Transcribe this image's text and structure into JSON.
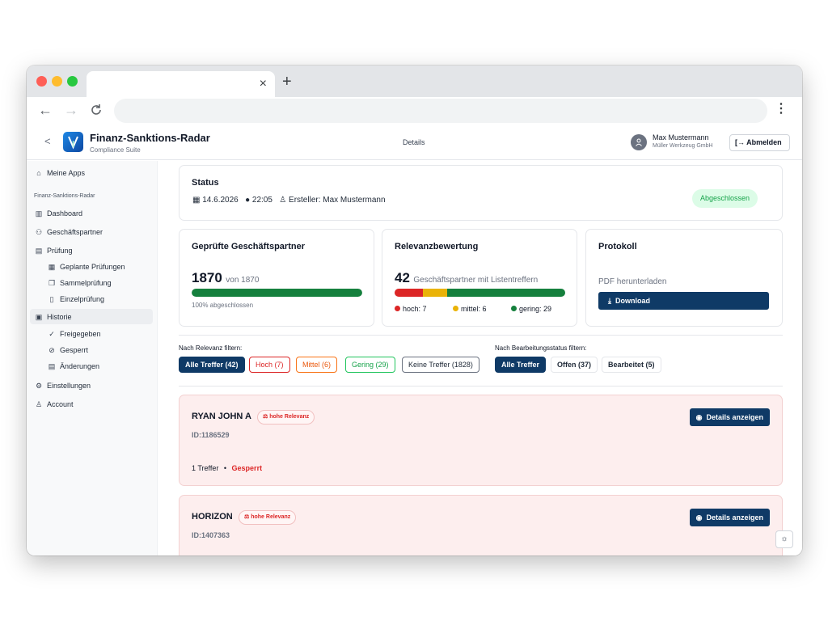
{
  "browser": {
    "tab_close": "×",
    "new_tab": "+",
    "back": "←",
    "forward": "→",
    "reload": "C",
    "menu": "⋮"
  },
  "header": {
    "back": "<",
    "app_title": "Finanz-Sanktions-Radar",
    "app_subtitle": "Compliance Suite",
    "center": "Details",
    "user_name": "Max Mustermann",
    "user_company": "Müller Werkzeug GmbH",
    "logout": "Abmelden"
  },
  "sidebar": {
    "my_apps": "Meine Apps",
    "section": "Finanz-Sanktions-Radar",
    "dashboard": "Dashboard",
    "partners": "Geschäftspartner",
    "pruefung": "Prüfung",
    "geplant": "Geplante Prüfungen",
    "sammel": "Sammelprüfung",
    "einzel": "Einzelprüfung",
    "historie": "Historie",
    "freigegeben": "Freigegeben",
    "gesperrt": "Gesperrt",
    "aenderungen": "Änderungen",
    "einstellungen": "Einstellungen",
    "account": "Account"
  },
  "status": {
    "title": "Status",
    "date": "14.6.2026",
    "time": "22:05",
    "creator": "Ersteller: Max Mustermann",
    "badge": "Abgeschlossen"
  },
  "checked": {
    "title": "Geprüfte Geschäftspartner",
    "count": "1870",
    "of": "von 1870",
    "progress": 1.0,
    "progress_text": "100% abgeschlossen"
  },
  "relevance": {
    "title": "Relevanzbewertung",
    "count": "42",
    "text": "Geschäftspartner mit Listentreffern",
    "high": "hoch: 7",
    "medium": "mittel: 6",
    "low": "gering: 29",
    "segments": [
      7,
      6,
      29
    ],
    "colors": {
      "high": "#dc2626",
      "medium": "#eab308",
      "low": "#15803d"
    }
  },
  "protocol": {
    "title": "Protokoll",
    "text": "PDF herunterladen",
    "button": "Download"
  },
  "filters": {
    "relevance_label": "Nach Relevanz filtern:",
    "status_label": "Nach Bearbeitungsstatus filtern:",
    "all": "Alle Treffer (42)",
    "high": "Hoch (7)",
    "medium": "Mittel (6)",
    "low": "Gering (29)",
    "none": "Keine Treffer (1828)",
    "status_all": "Alle Treffer",
    "open": "Offen (37)",
    "done": "Bearbeitet (5)"
  },
  "results": [
    {
      "name": "RYAN JOHN A",
      "badge": "hohe Relevanz",
      "id": "ID:1186529",
      "hits": "1 Treffer",
      "sep": "•",
      "state": "Gesperrt",
      "button": "Details anzeigen"
    },
    {
      "name": "HORIZON",
      "badge": "hohe Relevanz",
      "id": "ID:1407363",
      "button": "Details anzeigen"
    }
  ],
  "theme_toggle": "☼",
  "colors": {
    "primary": "#0f3a66",
    "danger": "#dc2626",
    "success": "#16a34a"
  }
}
